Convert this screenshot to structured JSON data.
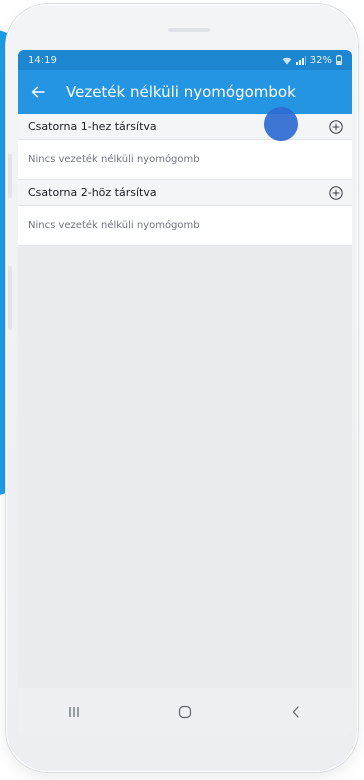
{
  "status_bar": {
    "time": "14:19",
    "battery": "32%",
    "icons": [
      "wifi-icon",
      "signal-icon",
      "battery-icon"
    ]
  },
  "app_bar": {
    "back_icon": "arrow-left-icon",
    "title": "Vezeték nélküli nyomógombok"
  },
  "sections": [
    {
      "label": "Csatorna 1-hez társítva",
      "add_icon": "plus-circle-icon",
      "empty_text": "Nincs vezeték nélküli nyomógomb"
    },
    {
      "label": "Csatorna 2-höz társítva",
      "add_icon": "plus-circle-icon",
      "empty_text": "Nincs vezeték nélküli nyomógomb"
    }
  ],
  "nav_bar": {
    "icons": [
      "recent-apps-icon",
      "home-icon",
      "back-icon"
    ]
  },
  "colors": {
    "accent": "#2395e3",
    "status_bar": "#1c86d1",
    "touch_indicator": "#2e6ad1",
    "screen_background": "#eaedf0"
  }
}
